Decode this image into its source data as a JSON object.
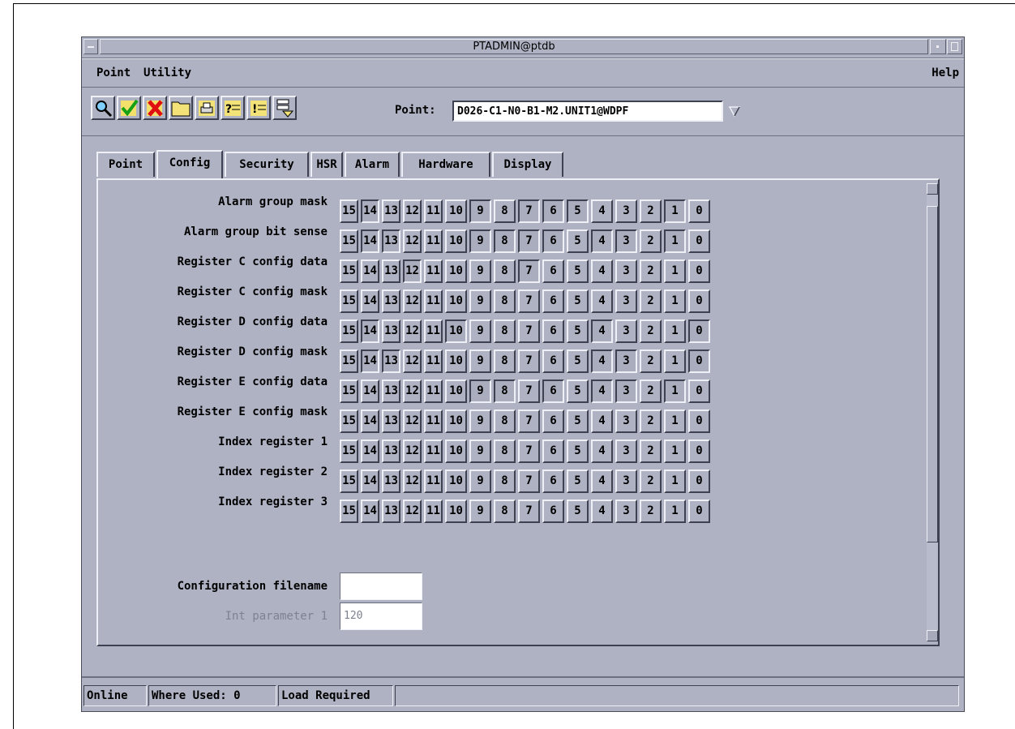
{
  "window": {
    "title": "PTADMIN@ptdb"
  },
  "menubar": {
    "left": "Point",
    "left2": "Utility",
    "help": "Help"
  },
  "toolbar": {
    "icons": [
      "search-icon",
      "check-icon",
      "delete-icon",
      "folder-icon",
      "print-icon",
      "help-list-icon",
      "info-list-icon",
      "hierarchy-icon"
    ],
    "point_label": "Point:",
    "point_value": "D026-C1-N0-B1-M2.UNIT1@WDPF"
  },
  "tabs": [
    "Point",
    "Config",
    "Security",
    "HSR",
    "Alarm",
    "Hardware",
    "Display"
  ],
  "active_tab": "Config",
  "bit_labels": [
    "15",
    "14",
    "13",
    "12",
    "11",
    "10",
    "9",
    "8",
    "7",
    "6",
    "5",
    "4",
    "3",
    "2",
    "1",
    "0"
  ],
  "rows": [
    {
      "label": "Alarm group mask",
      "on": [
        14,
        9,
        7,
        6,
        5,
        1
      ]
    },
    {
      "label": "Alarm group bit sense",
      "on": [
        14,
        13,
        9,
        8,
        7,
        6,
        4,
        3,
        1
      ]
    },
    {
      "label": "Register C config data",
      "on": [
        12,
        7
      ]
    },
    {
      "label": "Register C config mask",
      "on": []
    },
    {
      "label": "Register D config data",
      "on": [
        14,
        10,
        4,
        0
      ]
    },
    {
      "label": "Register D config mask",
      "on": [
        14,
        13,
        4,
        3,
        0
      ]
    },
    {
      "label": "Register E config data",
      "on": [
        9,
        8,
        6,
        4,
        3,
        1
      ]
    },
    {
      "label": "Register E config mask",
      "on": []
    },
    {
      "label": "Index register 1",
      "on": []
    },
    {
      "label": "Index register 2",
      "on": []
    },
    {
      "label": "Index register 3",
      "on": []
    }
  ],
  "fields": {
    "config_filename_label": "Configuration filename",
    "config_filename_value": "",
    "int_param_label": "Int parameter 1",
    "int_param_value": "120"
  },
  "status": {
    "online": "Online",
    "where_used": "Where Used: 0",
    "load": "Load Required"
  }
}
